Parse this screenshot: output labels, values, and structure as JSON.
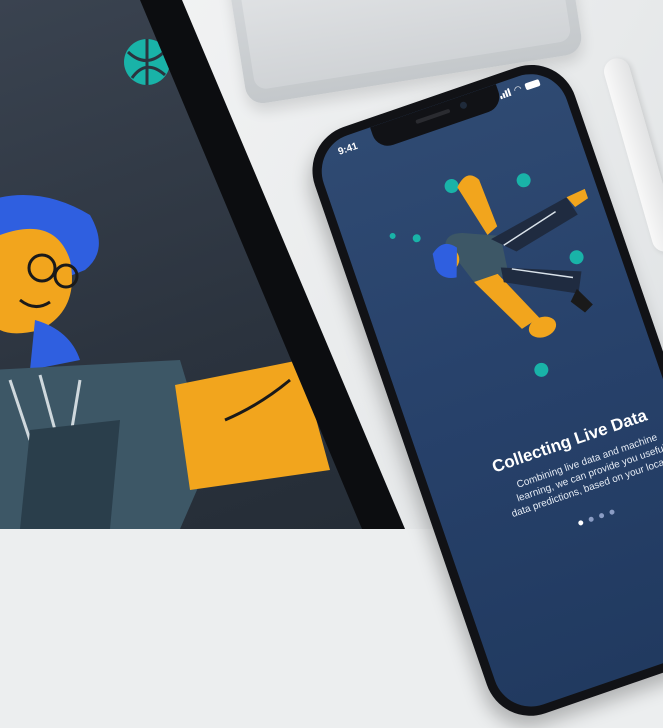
{
  "phone": {
    "status_time": "9:41",
    "title": "Collecting Live Data",
    "body_lines": [
      "Combining live data and machine",
      "learning, we can provide you useful",
      "data predictions, based on your location"
    ],
    "page_indicator": {
      "total": 4,
      "active": 1
    }
  },
  "colors": {
    "phone_screen": "#27416a",
    "tablet_screen": "#2b333e",
    "accent_orange": "#f2a51d",
    "accent_teal": "#19b3a8",
    "hair_blue": "#2f5fe0"
  }
}
